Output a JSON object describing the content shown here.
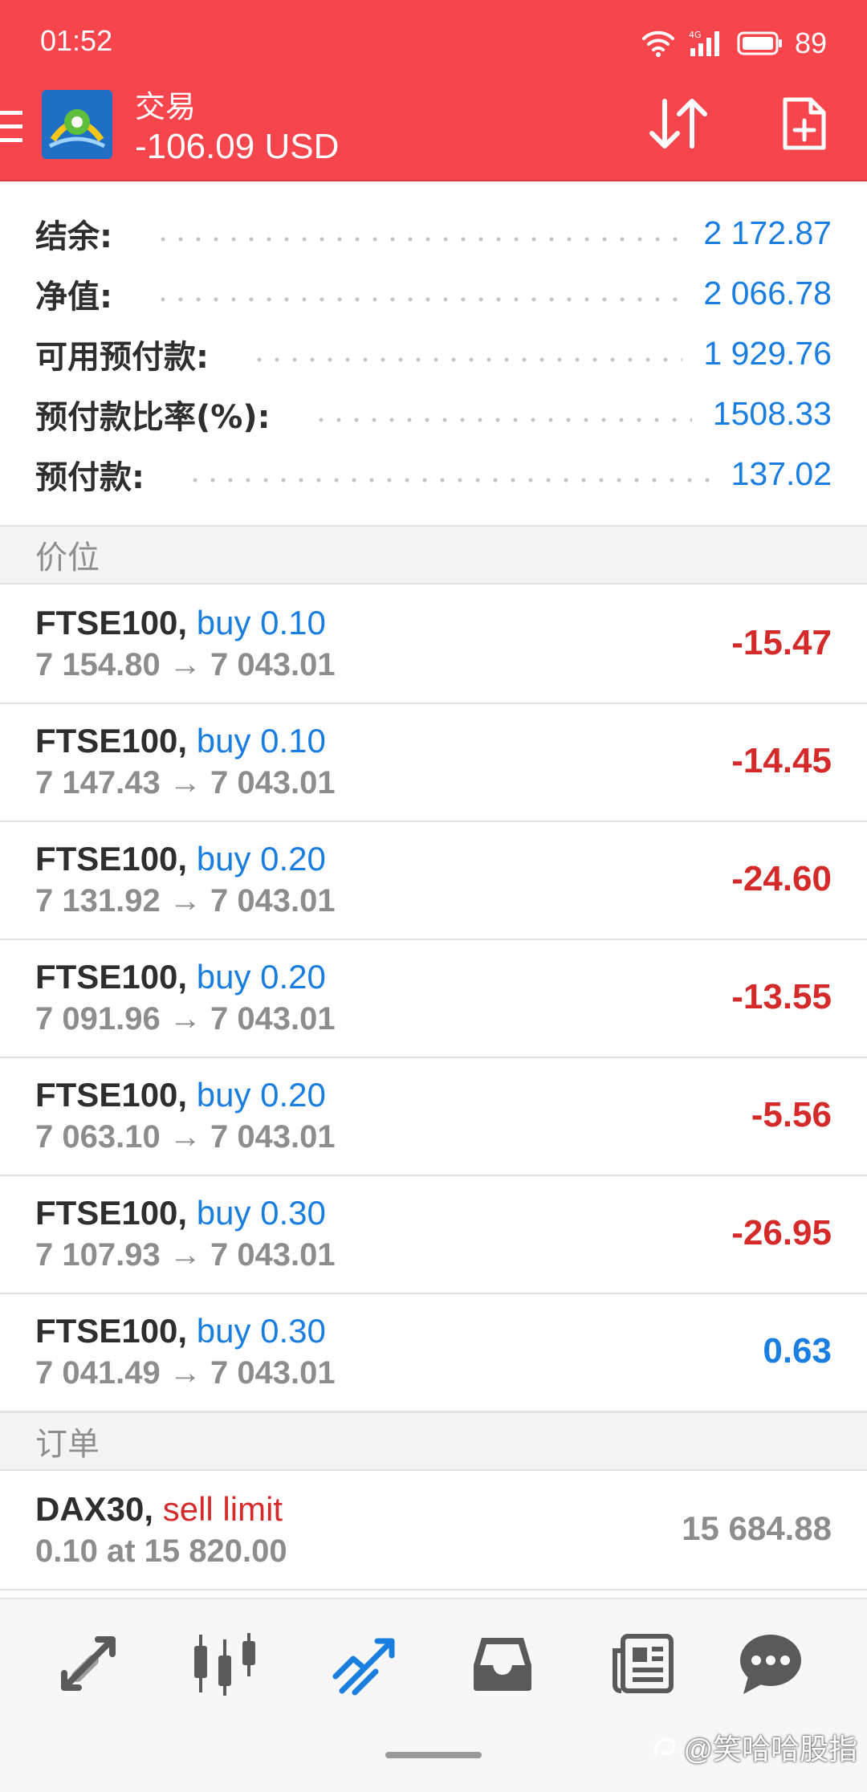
{
  "status_bar": {
    "time": "01:52",
    "network": "4G",
    "battery": "89"
  },
  "header": {
    "title": "交易",
    "balance": "-106.09 USD",
    "background_color": "#f6454c"
  },
  "summary": [
    {
      "label": "结余:",
      "value": "2 172.87"
    },
    {
      "label": "净值:",
      "value": "2 066.78"
    },
    {
      "label": "可用预付款:",
      "value": "1 929.76"
    },
    {
      "label": "预付款比率(%):",
      "value": "1508.33"
    },
    {
      "label": "预付款:",
      "value": "137.02"
    }
  ],
  "positions_section": {
    "title": "价位"
  },
  "positions": [
    {
      "symbol": "FTSE100,",
      "side": "buy 0.10",
      "open": "7 154.80",
      "current": "7 043.01",
      "profit": "-15.47"
    },
    {
      "symbol": "FTSE100,",
      "side": "buy 0.10",
      "open": "7 147.43",
      "current": "7 043.01",
      "profit": "-14.45"
    },
    {
      "symbol": "FTSE100,",
      "side": "buy 0.20",
      "open": "7 131.92",
      "current": "7 043.01",
      "profit": "-24.60"
    },
    {
      "symbol": "FTSE100,",
      "side": "buy 0.20",
      "open": "7 091.96",
      "current": "7 043.01",
      "profit": "-13.55"
    },
    {
      "symbol": "FTSE100,",
      "side": "buy 0.20",
      "open": "7 063.10",
      "current": "7 043.01",
      "profit": "-5.56"
    },
    {
      "symbol": "FTSE100,",
      "side": "buy 0.30",
      "open": "7 107.93",
      "current": "7 043.01",
      "profit": "-26.95"
    },
    {
      "symbol": "FTSE100,",
      "side": "buy 0.30",
      "open": "7 041.49",
      "current": "7 043.01",
      "profit": "0.63"
    }
  ],
  "arrow": "→",
  "orders_section": {
    "title": "订单"
  },
  "orders": [
    {
      "symbol": "DAX30,",
      "type": "sell limit",
      "detail": "0.10 at 15 820.00",
      "price": "15 684.88"
    }
  ],
  "bottom_nav": [
    {
      "icon": "quotes-icon"
    },
    {
      "icon": "chart-icon"
    },
    {
      "icon": "trade-icon",
      "active": true
    },
    {
      "icon": "history-icon"
    },
    {
      "icon": "news-icon"
    },
    {
      "icon": "messages-icon"
    }
  ],
  "watermark": "@笑哈哈股指",
  "colors": {
    "accent": "#1a7ee0",
    "loss": "#d42a2a",
    "muted": "#8d8d8d",
    "active_nav": "#1a7ee0",
    "inactive_nav": "#5a5a5a"
  }
}
